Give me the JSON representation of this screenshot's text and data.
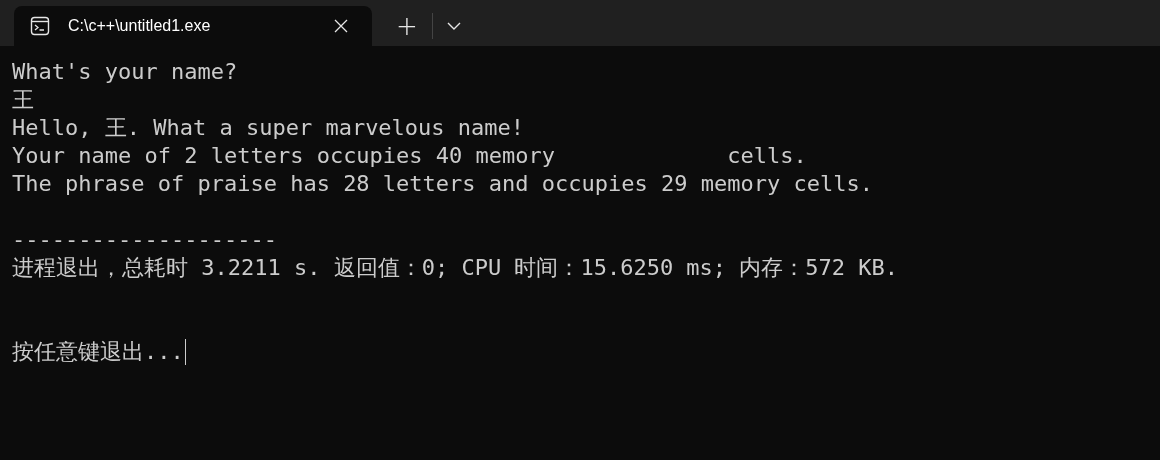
{
  "tabs": [
    {
      "title": "C:\\c++\\untitled1.exe",
      "selected": true
    }
  ],
  "new_tab": "+",
  "console": {
    "output": [
      "What's your name?",
      "王",
      "Hello, 王. What a super marvelous name!",
      "Your name of 2 letters occupies 40 memory             cells.",
      "The phrase of praise has 28 letters and occupies 29 memory cells."
    ],
    "separator": "--------------------",
    "exit_status": "进程退出，总耗时 3.2211 s. 返回值：0; CPU 时间：15.6250 ms; 内存：572 KB.",
    "prompt": "按任意键退出..."
  }
}
